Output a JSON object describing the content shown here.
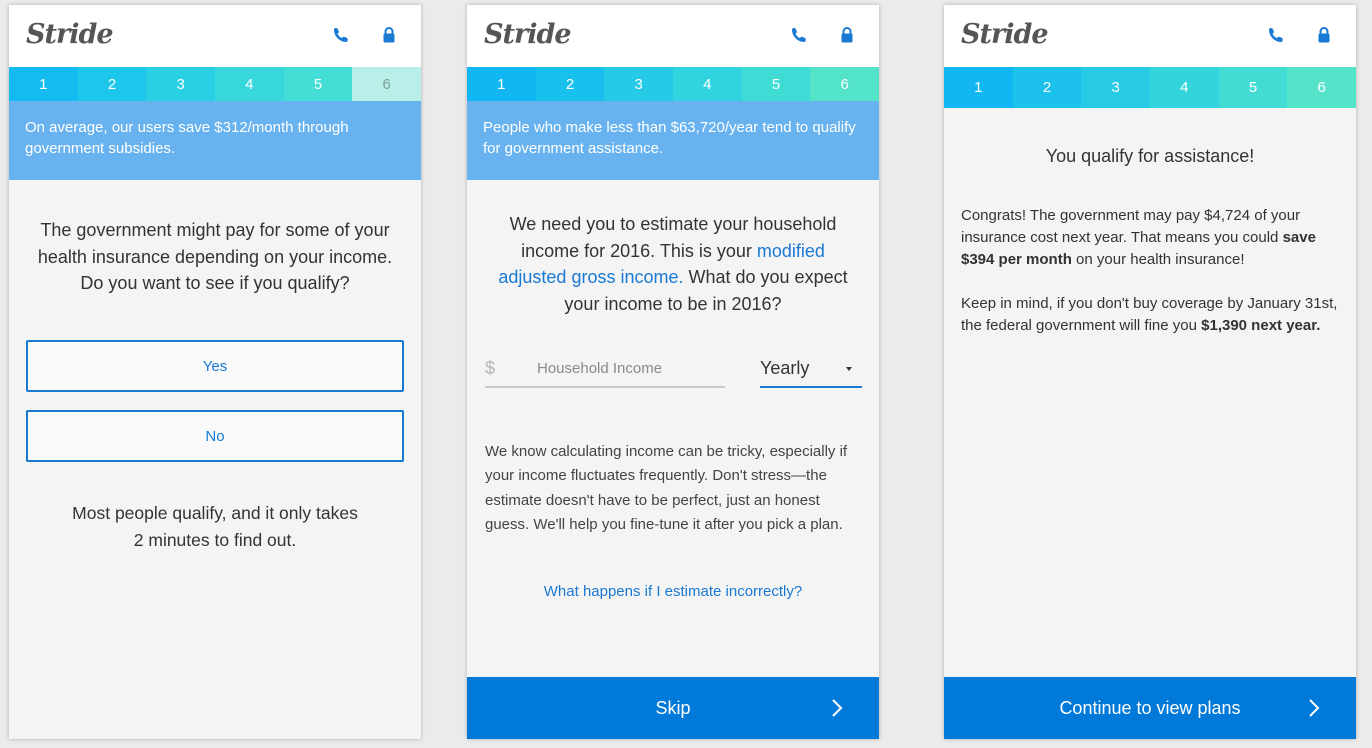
{
  "brand": {
    "logo_text": "Stride",
    "phone_icon": "phone-icon",
    "lock_icon": "lock-icon"
  },
  "steps": [
    "1",
    "2",
    "3",
    "4",
    "5",
    "6"
  ],
  "colors": {
    "accent": "#0079d9",
    "banner": "#68b3ef",
    "link": "#1a79d3"
  },
  "screen1": {
    "banner": "On average, our users save $312/month through government subsidies.",
    "question": "The government might pay for some of your health insurance depending on your income. Do you want to see if you qualify?",
    "yes_label": "Yes",
    "no_label": "No",
    "note_line1": "Most people qualify, and it only takes",
    "note_line2": "2 minutes to find out."
  },
  "screen2": {
    "banner": "People who make less than $63,720/year tend to qualify for government assistance.",
    "question_before": "We need you to estimate your household income for 2016. This is your ",
    "question_link": "modified adjusted gross income.",
    "question_after": " What do you expect your income to be in 2016?",
    "currency_symbol": "$",
    "income_placeholder": "Household Income",
    "period_value": "Yearly",
    "help_text": "We know calculating income can be tricky, especially if your income fluctuates frequently. Don't stress—the estimate doesn't have to be perfect, just an honest guess. We'll help you fine-tune it after you pick a plan.",
    "faq_link": "What happens if I estimate incorrectly?",
    "skip_label": "Skip"
  },
  "screen3": {
    "title": "You qualify for assistance!",
    "p1_before": "Congrats! The government may pay $4,724 of your insurance cost next year. That means you could ",
    "p1_bold": "save $394 per month",
    "p1_after": " on your health insurance!",
    "p2_before": "Keep in mind, if you don't buy coverage by January 31st, the federal government will fine you ",
    "p2_bold": "$1,390 next year.",
    "continue_label": "Continue to view plans"
  }
}
